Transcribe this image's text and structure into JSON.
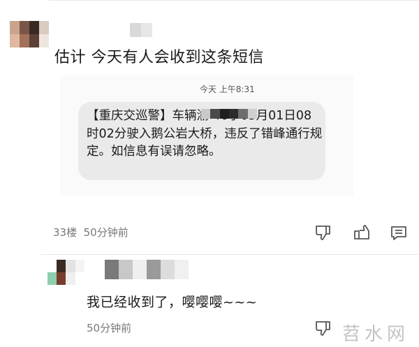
{
  "comment1": {
    "text": "估计 今天有人会收到这条短信",
    "floor": "33楼",
    "time": "50分钟前",
    "sms": {
      "timestamp": "今天 上午8:31",
      "body": "【重庆交巡警】车辆渝    46于03月01日08时02分驶入鹅公岩大桥，违反了错峰通行规定。如信息有误请忽略。"
    },
    "actions": [
      "thumbs-down-icon",
      "thumbs-up-icon",
      "comment-icon"
    ]
  },
  "comment2": {
    "text": "我已经收到了，嘤嘤嘤~~~",
    "time": "50分钟前",
    "actions": [
      "thumbs-down-icon"
    ]
  },
  "watermark": "苕水网",
  "colors": {
    "bubble": "#eaeaea",
    "meta_text": "#777777",
    "icon": "#555555"
  }
}
